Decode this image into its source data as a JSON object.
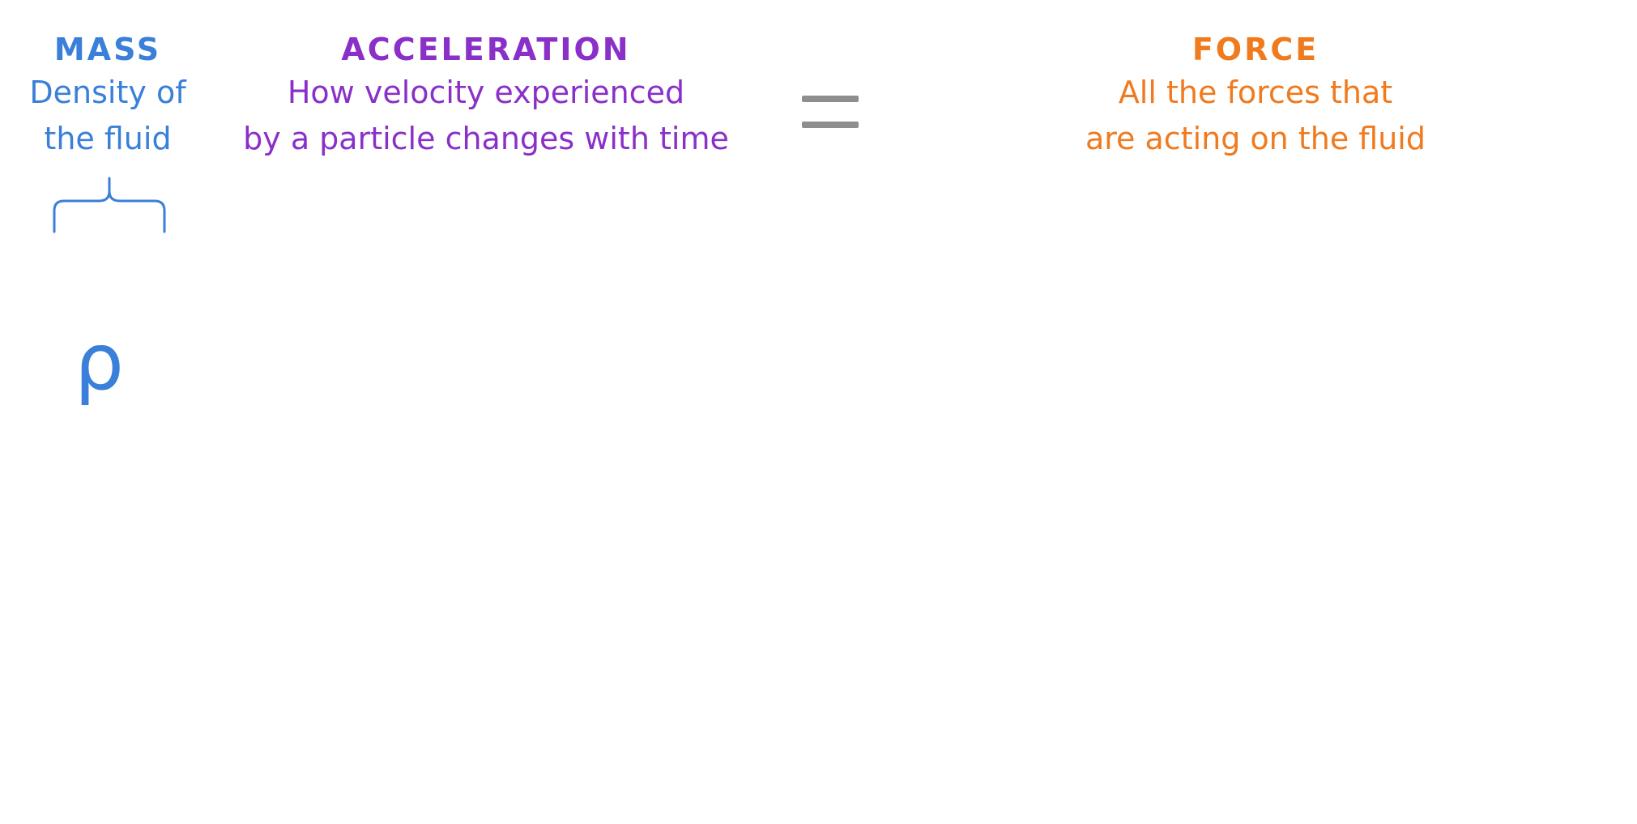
{
  "mass": {
    "heading": "MASS",
    "line1": "Density of",
    "line2": "the fluid",
    "symbol": "ρ",
    "color": "#3a7fd9"
  },
  "acceleration": {
    "heading": "ACCELERATION",
    "line1": "How velocity experienced",
    "line2": "by a particle changes with time",
    "color": "#8a30c8"
  },
  "equals": {
    "color": "#8e8e8e"
  },
  "force": {
    "heading": "FORCE",
    "line1": "All the forces that",
    "line2": "are acting on the fluid",
    "color": "#f07a1e"
  }
}
